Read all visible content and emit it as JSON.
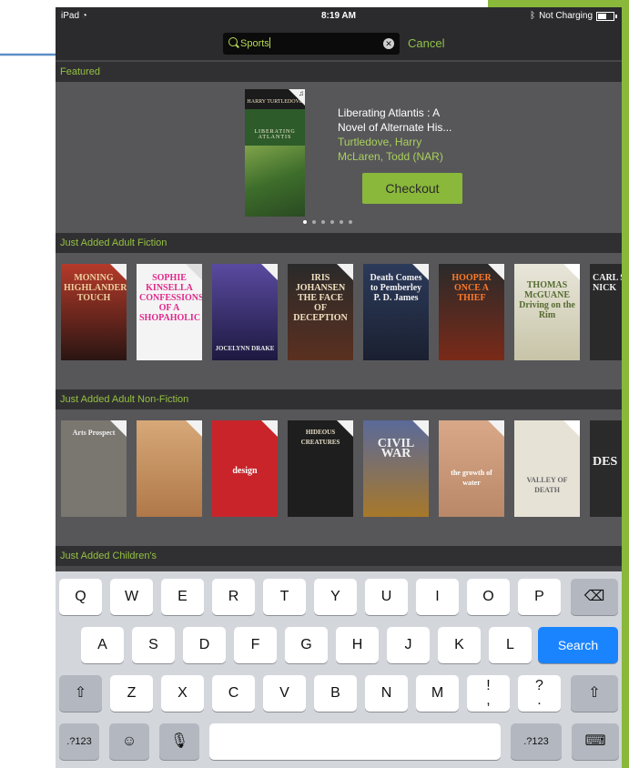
{
  "colors": {
    "accent_green": "#8ab83b",
    "section_text": "#94c040",
    "search_key": "#1a84ff",
    "annotation_arrow": "#5b8ec6"
  },
  "status_bar": {
    "device": "iPad",
    "wifi_icon": "wifi-icon",
    "time": "8:19 AM",
    "charging": "Not Charging",
    "battery_icon": "battery-icon"
  },
  "search": {
    "value": "Sports",
    "clear_icon": "clear-icon",
    "cancel_label": "Cancel"
  },
  "sections": {
    "featured": "Featured",
    "adult_fiction": "Just Added  Adult Fiction",
    "adult_nonfiction": "Just Added Adult Non-Fiction",
    "childrens": "Just Added Children's"
  },
  "featured": {
    "cover_author": "HARRY TURTLEDOVE",
    "cover_title": "LIBERATING ATLANTIS",
    "title_line1": "Liberating Atlantis : A",
    "title_line2": "Novel of Alternate His...",
    "author1": "Turtledove, Harry",
    "author2": "McLaren, Todd (NAR)",
    "checkout_label": "Checkout",
    "carousel_pages": 6,
    "carousel_current": 1
  },
  "adult_fiction_books": [
    {
      "cover": "MONING HIGHLANDER'S TOUCH"
    },
    {
      "cover": "SOPHIE KINSELLA CONFESSIONS OF A SHOPAHOLIC"
    },
    {
      "cover": "JOCELYNN DRAKE"
    },
    {
      "cover": "IRIS JOHANSEN THE FACE OF DECEPTION"
    },
    {
      "cover": "Death Comes to Pemberley P. D. James"
    },
    {
      "cover": "HOOPER ONCE A THIEF"
    },
    {
      "cover": "THOMAS McGUANE Driving on the Rim"
    },
    {
      "cover": "CARL STRE NICK"
    }
  ],
  "adult_nonfiction_books": [
    {
      "cover": "Arts Prospect"
    },
    {
      "cover": ""
    },
    {
      "cover": "design"
    },
    {
      "cover": "HIDEOUS CREATURES"
    },
    {
      "cover": "CIVIL WAR"
    },
    {
      "cover": "the growth of water"
    },
    {
      "cover": "VALLEY OF DEATH"
    },
    {
      "cover": "DES"
    }
  ],
  "keyboard": {
    "row1": [
      "Q",
      "W",
      "E",
      "R",
      "T",
      "Y",
      "U",
      "I",
      "O",
      "P"
    ],
    "row2": [
      "A",
      "S",
      "D",
      "F",
      "G",
      "H",
      "J",
      "K",
      "L"
    ],
    "row3": [
      "Z",
      "X",
      "C",
      "V",
      "B",
      "N",
      "M",
      "!\n,",
      "?\n."
    ],
    "numbers_label": ".?123",
    "search_label": "Search"
  }
}
